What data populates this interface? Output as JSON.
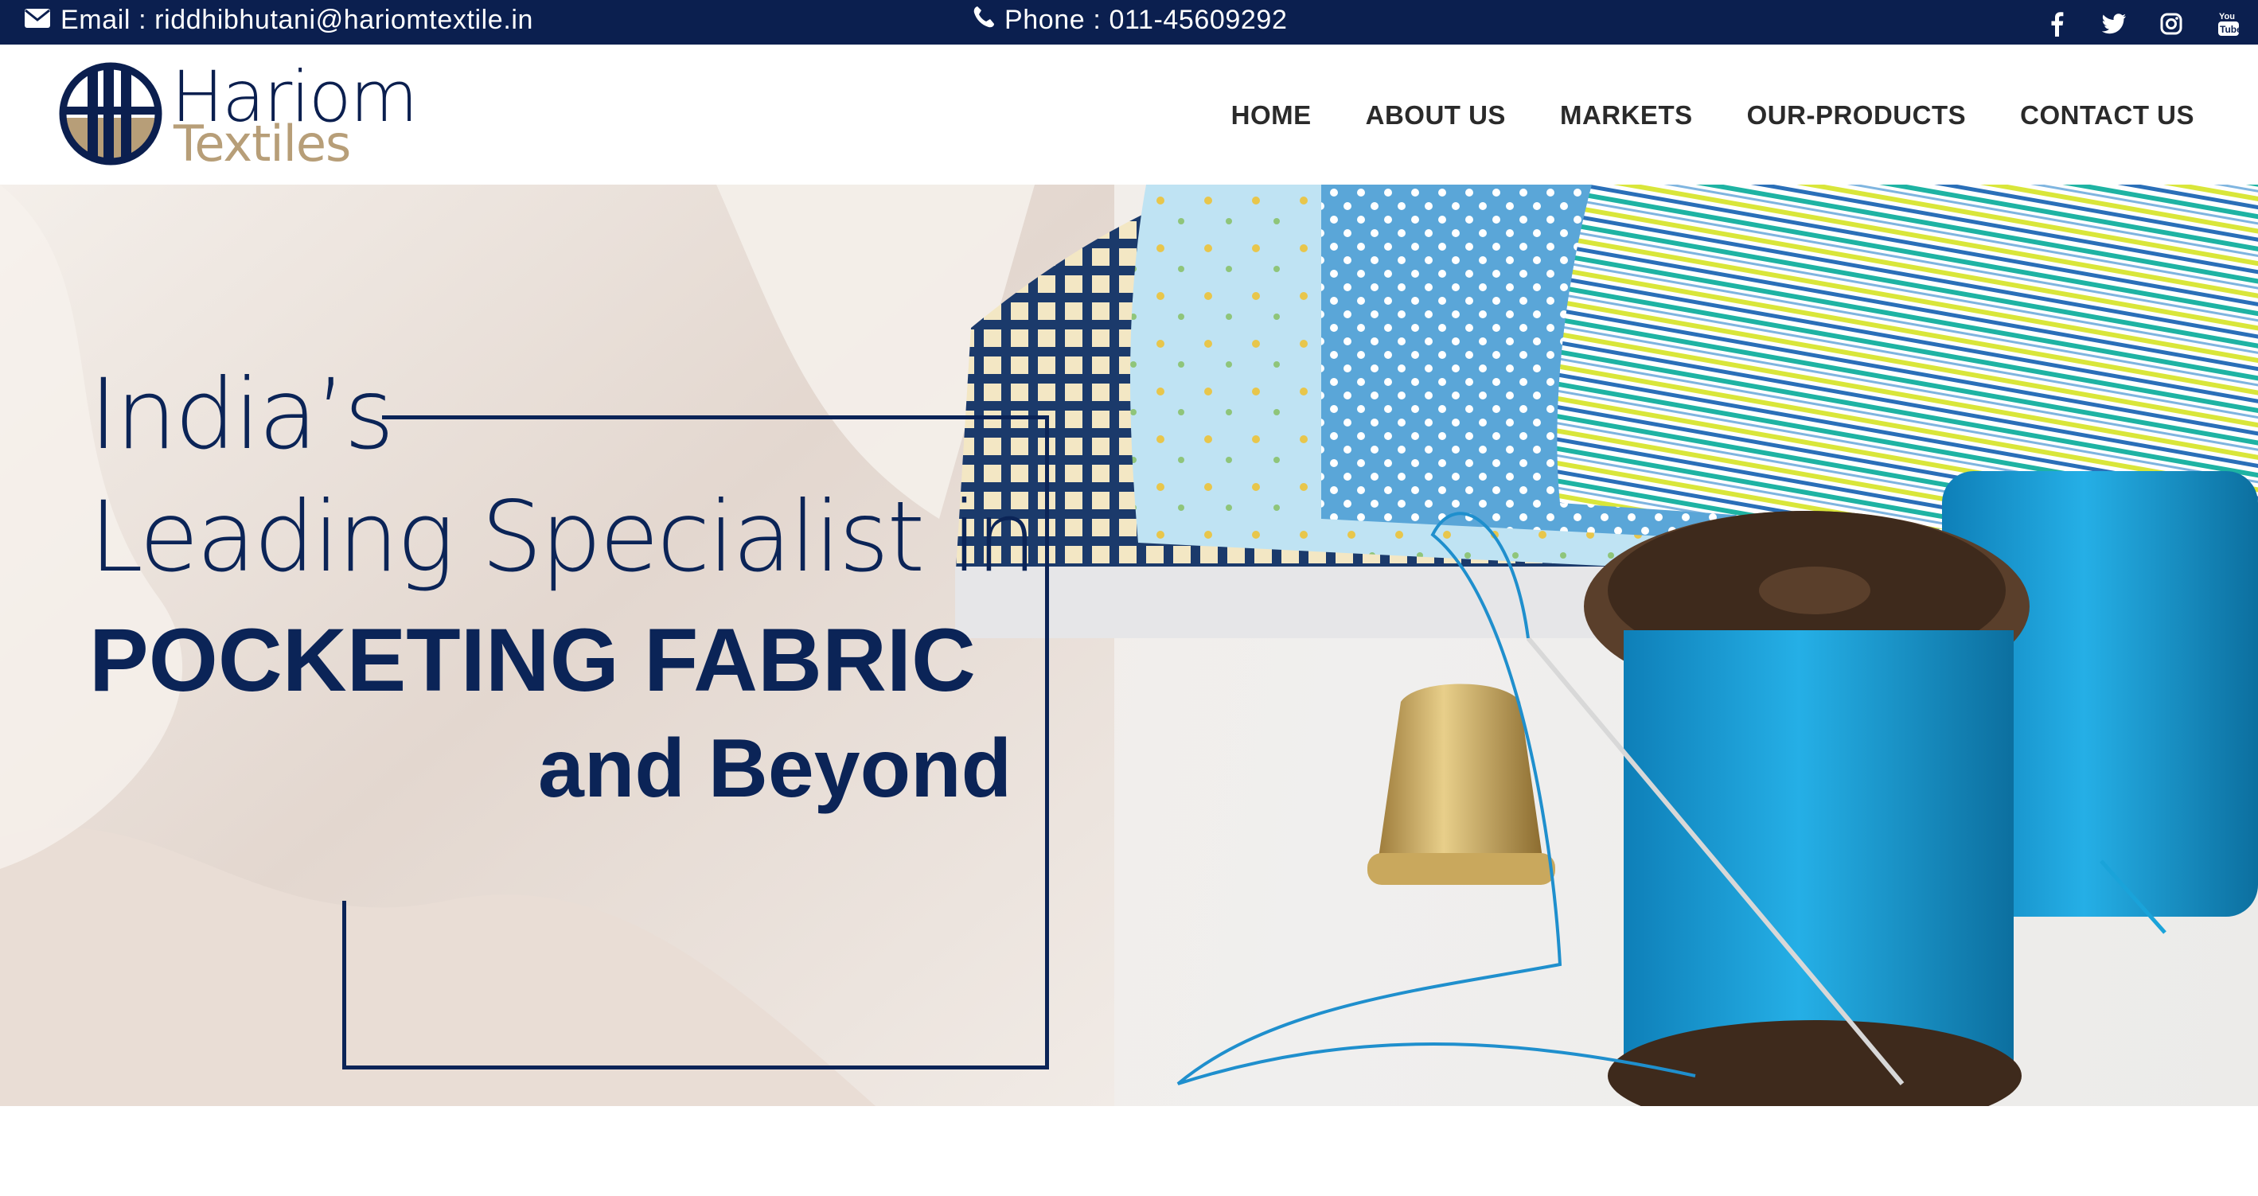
{
  "topbar": {
    "email_label": "Email : riddhibhutani@hariomtextile.in",
    "phone_label": "Phone : 011-45609292",
    "socials": [
      {
        "icon": "facebook-icon"
      },
      {
        "icon": "twitter-icon"
      },
      {
        "icon": "instagram-icon"
      },
      {
        "icon": "youtube-icon"
      }
    ]
  },
  "logo": {
    "line1": "Hariom",
    "line2": "Textiles"
  },
  "nav": {
    "items": [
      {
        "label": "HOME"
      },
      {
        "label": "ABOUT US"
      },
      {
        "label": "MARKETS"
      },
      {
        "label": "OUR-PRODUCTS"
      },
      {
        "label": "CONTACT US"
      }
    ]
  },
  "hero": {
    "line1": "India’s",
    "line2": "Leading Specialist in",
    "line3": "POCKETING FABRIC",
    "line4": "and Beyond",
    "slides_total": 4,
    "active_slide": 1
  },
  "colors": {
    "navy": "#0b1f4f",
    "headline": "#0b2457",
    "logo_gold": "#b79e78",
    "thread_blue": "#1aa3d9"
  }
}
